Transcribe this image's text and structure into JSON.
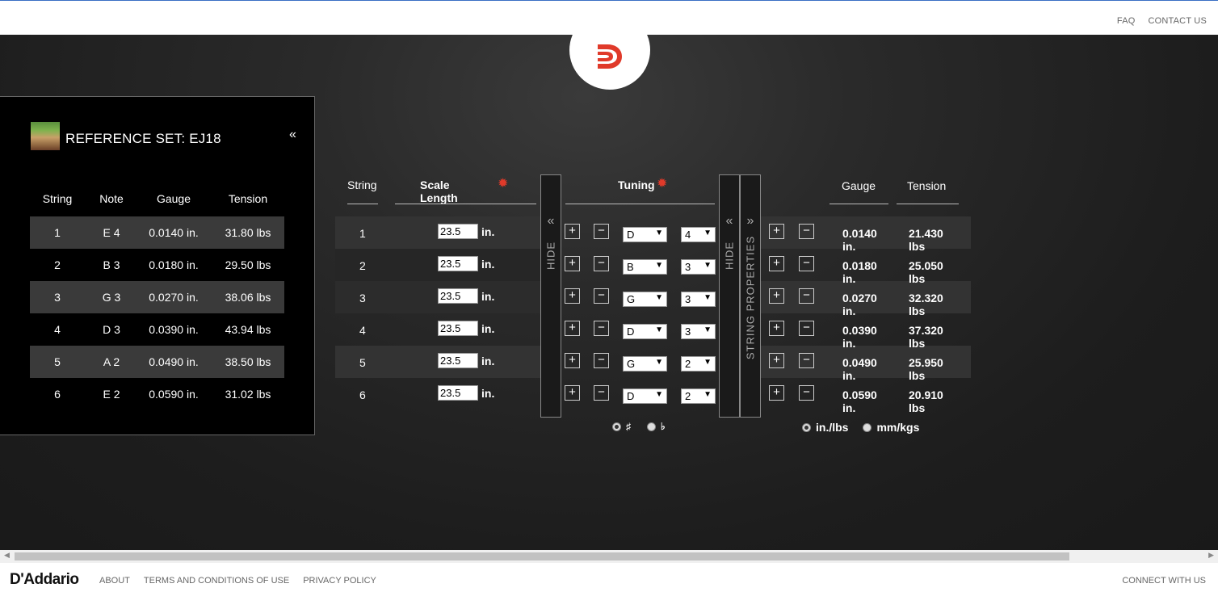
{
  "header": {
    "nav": [
      "FAQ",
      "CONTACT US"
    ]
  },
  "reference": {
    "title": "REFERENCE SET: EJ18",
    "collapse_icon": "«",
    "headers": [
      "String",
      "Note",
      "Gauge",
      "Tension"
    ],
    "rows": [
      {
        "string": "1",
        "note": "E 4",
        "gauge": "0.0140 in.",
        "tension": "31.80 lbs"
      },
      {
        "string": "2",
        "note": "B 3",
        "gauge": "0.0180 in.",
        "tension": "29.50 lbs"
      },
      {
        "string": "3",
        "note": "G 3",
        "gauge": "0.0270 in.",
        "tension": "38.06 lbs"
      },
      {
        "string": "4",
        "note": "D 3",
        "gauge": "0.0390 in.",
        "tension": "43.94 lbs"
      },
      {
        "string": "5",
        "note": "A 2",
        "gauge": "0.0490 in.",
        "tension": "38.50 lbs"
      },
      {
        "string": "6",
        "note": "E 2",
        "gauge": "0.0590 in.",
        "tension": "31.02 lbs"
      }
    ]
  },
  "calculator": {
    "headers": {
      "string": "String",
      "scale": "Scale Length",
      "tuning": "Tuning",
      "gauge": "Gauge",
      "tension": "Tension"
    },
    "unit_in": "in.",
    "hide_label": "HIDE",
    "props_label": "STRING PROPERTIES",
    "plus": "+",
    "minus": "−",
    "rows": [
      {
        "string": "1",
        "scale": "23.5",
        "note": "D",
        "octave": "4",
        "gauge": "0.0140 in.",
        "tension": "21.430 lbs"
      },
      {
        "string": "2",
        "scale": "23.5",
        "note": "B",
        "octave": "3",
        "gauge": "0.0180 in.",
        "tension": "25.050 lbs"
      },
      {
        "string": "3",
        "scale": "23.5",
        "note": "G",
        "octave": "3",
        "gauge": "0.0270 in.",
        "tension": "32.320 lbs"
      },
      {
        "string": "4",
        "scale": "23.5",
        "note": "D",
        "octave": "3",
        "gauge": "0.0390 in.",
        "tension": "37.320 lbs"
      },
      {
        "string": "5",
        "scale": "23.5",
        "note": "G",
        "octave": "2",
        "gauge": "0.0490 in.",
        "tension": "25.950 lbs"
      },
      {
        "string": "6",
        "scale": "23.5",
        "note": "D",
        "octave": "2",
        "gauge": "0.0590 in.",
        "tension": "20.910 lbs"
      }
    ],
    "accidentals": {
      "sharp": "♯",
      "flat": "♭",
      "selected": "sharp"
    },
    "units": {
      "imperial": "in./lbs",
      "metric": "mm/kgs",
      "selected": "imperial"
    }
  },
  "footer": {
    "brand": "D'Addario",
    "links": [
      "ABOUT",
      "TERMS AND CONDITIONS OF USE",
      "PRIVACY POLICY"
    ],
    "right": "CONNECT WITH US"
  },
  "colors": {
    "accent": "#e03a2a",
    "panel": "#000000",
    "band": "#333333"
  }
}
